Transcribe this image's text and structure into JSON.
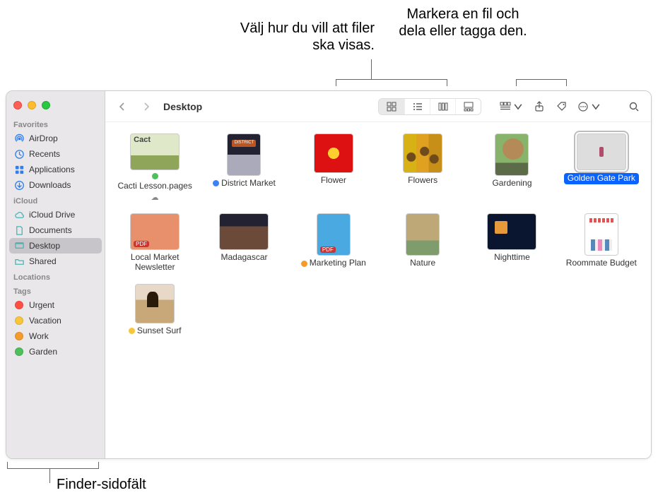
{
  "annotations": {
    "view_hint": "Välj hur du vill att filer ska visas.",
    "share_hint": "Markera en fil och dela eller tagga den.",
    "sidebar_hint": "Finder-sidofält"
  },
  "window": {
    "title": "Desktop"
  },
  "sidebar": {
    "sections": {
      "favorites": {
        "header": "Favorites",
        "items": [
          {
            "label": "AirDrop",
            "icon": "airdrop"
          },
          {
            "label": "Recents",
            "icon": "clock"
          },
          {
            "label": "Applications",
            "icon": "apps"
          },
          {
            "label": "Downloads",
            "icon": "download"
          }
        ]
      },
      "icloud": {
        "header": "iCloud",
        "items": [
          {
            "label": "iCloud Drive",
            "icon": "cloud"
          },
          {
            "label": "Documents",
            "icon": "doc"
          },
          {
            "label": "Desktop",
            "icon": "desktop",
            "selected": true
          },
          {
            "label": "Shared",
            "icon": "folder"
          }
        ]
      },
      "locations": {
        "header": "Locations"
      },
      "tags": {
        "header": "Tags",
        "items": [
          {
            "label": "Urgent",
            "color": "#ff4f44"
          },
          {
            "label": "Vacation",
            "color": "#f8c63a"
          },
          {
            "label": "Work",
            "color": "#f59b2e"
          },
          {
            "label": "Garden",
            "color": "#4fbf5b"
          }
        ]
      }
    }
  },
  "files": [
    {
      "name": "Cacti Lesson.pages",
      "tag": "#4fbf5b",
      "cloud": true,
      "thumb": "t-cacti",
      "shape": "thumb"
    },
    {
      "name": "District Market",
      "tag": "#3b82f6",
      "thumb": "t-district",
      "shape": "thumb-tall"
    },
    {
      "name": "Flower",
      "thumb": "t-flower",
      "shape": "thumb-sq"
    },
    {
      "name": "Flowers",
      "thumb": "t-flowers",
      "shape": "thumb-sq"
    },
    {
      "name": "Gardening",
      "thumb": "t-garden",
      "shape": "thumb-tall"
    },
    {
      "name": "Golden Gate Park",
      "thumb": "t-ggp",
      "shape": "thumb",
      "selected": true
    },
    {
      "name": "Local Market Newsletter",
      "thumb": "t-localnews",
      "shape": "thumb"
    },
    {
      "name": "Madagascar",
      "thumb": "t-mada",
      "shape": "thumb"
    },
    {
      "name": "Marketing Plan",
      "tag": "#f59b2e",
      "thumb": "t-marketing",
      "shape": "thumb-tall"
    },
    {
      "name": "Nature",
      "thumb": "t-nature",
      "shape": "thumb-tall"
    },
    {
      "name": "Nighttime",
      "thumb": "t-night",
      "shape": "thumb"
    },
    {
      "name": "Roommate Budget",
      "thumb": "t-room",
      "shape": "thumb-tall"
    },
    {
      "name": "Sunset Surf",
      "tag": "#f8c63a",
      "thumb": "t-sunset",
      "shape": "thumb-sq"
    }
  ],
  "colors": {
    "selection": "#0a63ff",
    "sidebar_icon": "#2f7ff0"
  }
}
